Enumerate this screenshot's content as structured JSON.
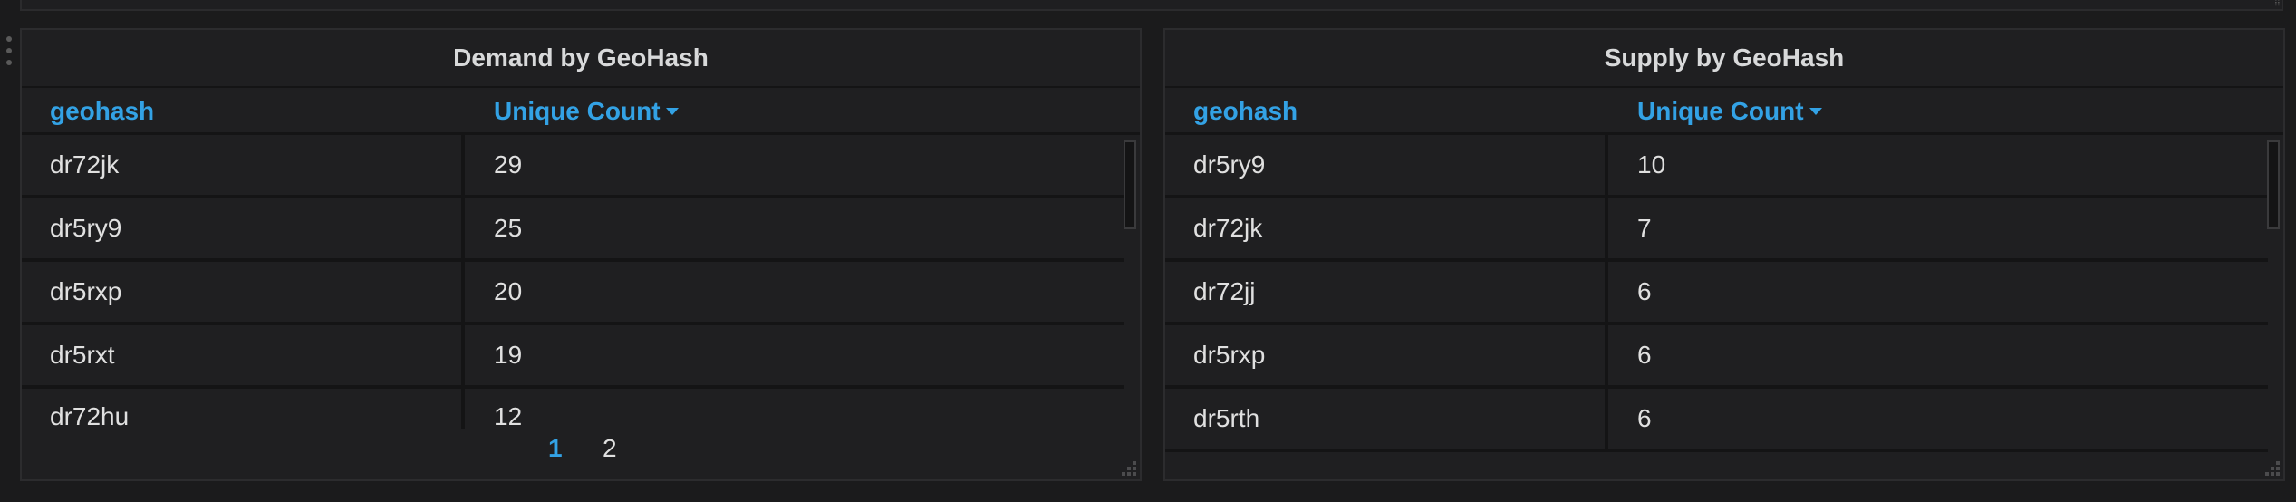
{
  "panels": [
    {
      "title": "Demand by GeoHash",
      "headers": {
        "geohash": "geohash",
        "count": "Unique Count"
      },
      "rows": [
        {
          "geohash": "dr72jk",
          "count": "29"
        },
        {
          "geohash": "dr5ry9",
          "count": "25"
        },
        {
          "geohash": "dr5rxp",
          "count": "20"
        },
        {
          "geohash": "dr5rxt",
          "count": "19"
        },
        {
          "geohash": "dr72hu",
          "count": "12"
        }
      ],
      "pagination": {
        "pages": [
          "1",
          "2"
        ],
        "current": "1"
      }
    },
    {
      "title": "Supply by GeoHash",
      "headers": {
        "geohash": "geohash",
        "count": "Unique Count"
      },
      "rows": [
        {
          "geohash": "dr5ry9",
          "count": "10"
        },
        {
          "geohash": "dr72jk",
          "count": "7"
        },
        {
          "geohash": "dr72jj",
          "count": "6"
        },
        {
          "geohash": "dr5rxp",
          "count": "6"
        },
        {
          "geohash": "dr5rth",
          "count": "6"
        }
      ]
    }
  ],
  "icons": {
    "sort": "caret-down-icon",
    "drag": "drag-handle-icon",
    "resize": "resize-grip-icon"
  },
  "colors": {
    "background": "#1b1b1c",
    "panel": "#1f1f21",
    "header_accent": "#33a2e5",
    "text": "#e0e0e0"
  }
}
